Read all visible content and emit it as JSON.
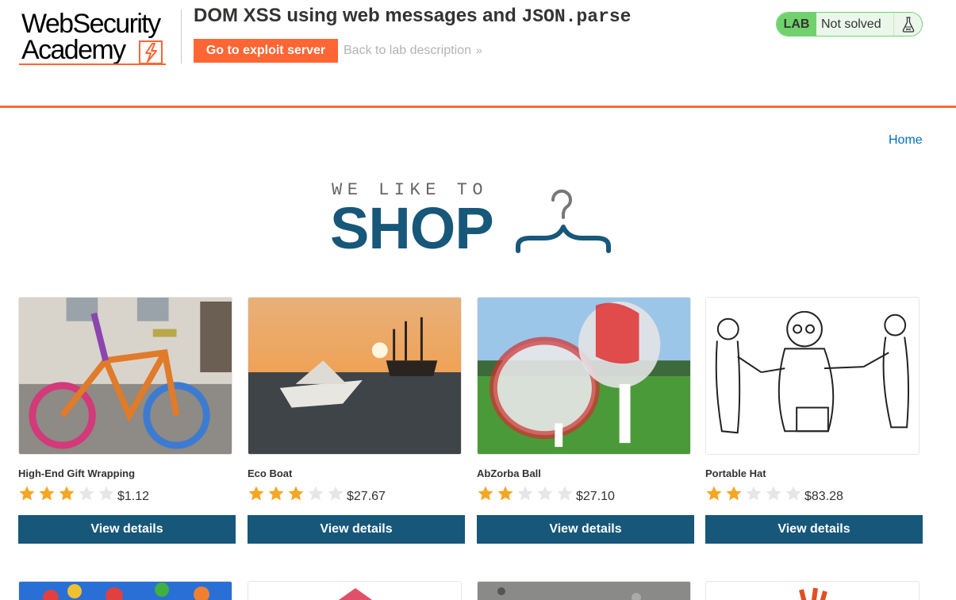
{
  "header": {
    "logo_line1": "WebSecurity",
    "logo_line2": "Academy",
    "lab_title_prefix": "DOM XSS using web messages and ",
    "lab_title_code": "JSON.parse",
    "exploit_button": "Go to exploit server",
    "back_link": "Back to lab description",
    "back_link_chevron": "»",
    "lab_badge": "LAB",
    "lab_state": "Not solved",
    "colors": {
      "accent": "#ff6633",
      "solved_green": "#70d16d"
    }
  },
  "nav": {
    "home_link": "Home"
  },
  "banner": {
    "small_text": "WE LIKE TO",
    "big_text": "SHOP",
    "icon": "hanger-icon"
  },
  "products": [
    {
      "name": "High-End Gift Wrapping",
      "rating": 3,
      "max_rating": 5,
      "price": "$1.12",
      "button": "View details"
    },
    {
      "name": "Eco Boat",
      "rating": 3,
      "max_rating": 5,
      "price": "$27.67",
      "button": "View details"
    },
    {
      "name": "AbZorba Ball",
      "rating": 2,
      "max_rating": 5,
      "price": "$27.10",
      "button": "View details"
    },
    {
      "name": "Portable Hat",
      "rating": 2,
      "max_rating": 5,
      "price": "$83.28",
      "button": "View details"
    }
  ]
}
